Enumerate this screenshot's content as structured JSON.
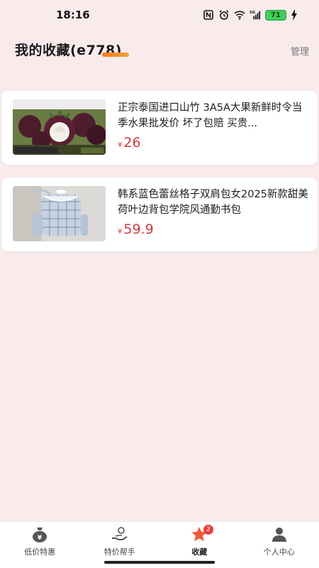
{
  "status_bar": {
    "time": "18:16",
    "battery": "71",
    "icons": [
      "nfc-icon",
      "alarm-icon",
      "wifi-icon",
      "5g-signal-icon",
      "battery-icon",
      "charging-icon"
    ]
  },
  "header": {
    "title": "我的收藏(e778)",
    "manage_label": "管理"
  },
  "favorites": [
    {
      "title": "正宗泰国进口山竹 3A5A大果新鲜时令当季水果批发价 坏了包赔 买贵...",
      "currency": "¥",
      "price": "26",
      "thumb_icon": "mangosteen-image"
    },
    {
      "title": "韩系蓝色蕾丝格子双肩包女2025新款甜美荷叶边背包学院风通勤书包",
      "currency": "¥",
      "price": "59.9",
      "thumb_icon": "plaid-backpack-image"
    }
  ],
  "tabs": [
    {
      "label": "低价特惠",
      "icon": "money-bag-icon",
      "active": false
    },
    {
      "label": "特价帮手",
      "icon": "helper-hand-icon",
      "active": false
    },
    {
      "label": "收藏",
      "icon": "star-icon",
      "active": true,
      "badge": "2"
    },
    {
      "label": "个人中心",
      "icon": "person-icon",
      "active": false
    }
  ],
  "colors": {
    "background": "#f9ebec",
    "price": "#d23a3f",
    "accent": "#f37a1a",
    "badge": "#e8413f",
    "battery": "#3fcf5a"
  }
}
